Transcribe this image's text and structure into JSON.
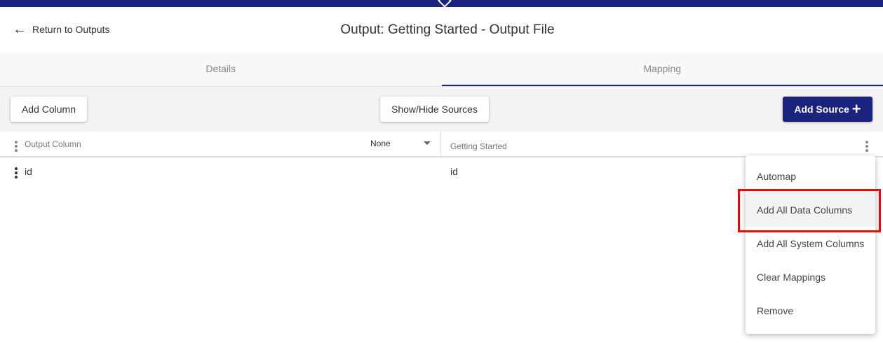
{
  "header": {
    "back_label": "Return to Outputs",
    "title": "Output: Getting Started - Output File"
  },
  "tabs": [
    {
      "label": "Details"
    },
    {
      "label": "Mapping",
      "active": true
    }
  ],
  "toolbar": {
    "add_column": "Add Column",
    "show_hide": "Show/Hide Sources",
    "add_source": "Add Source"
  },
  "table": {
    "output_column_header": "Output Column",
    "select_value": "None",
    "source_header": "Getting Started",
    "rows": [
      {
        "output": "id",
        "source": "id"
      }
    ]
  },
  "menu": {
    "items": [
      "Automap",
      "Add All Data Columns",
      "Add All System Columns",
      "Clear Mappings",
      "Remove"
    ],
    "highlighted": "Add All Data Columns"
  },
  "colors": {
    "brand": "#1a237e",
    "highlight_box": "#ff0000"
  }
}
